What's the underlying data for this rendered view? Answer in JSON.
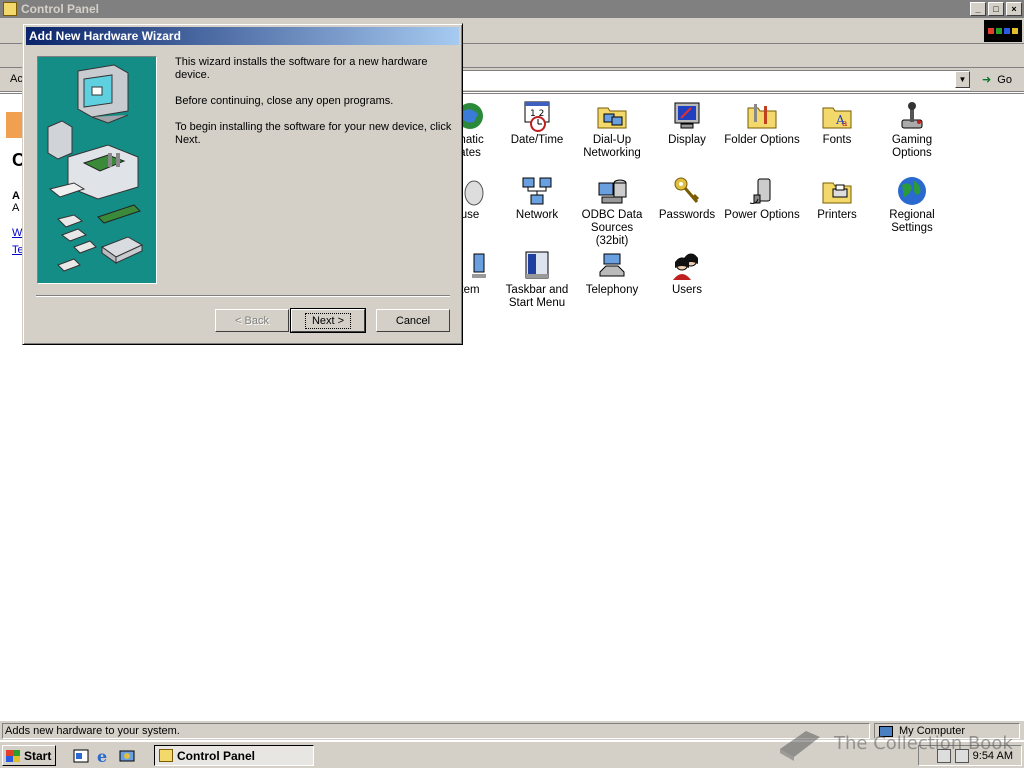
{
  "window": {
    "title": "Control Panel",
    "buttons": {
      "minimize": "_",
      "maximize": "□",
      "close": "×"
    }
  },
  "address": {
    "label_fragment": "Ac",
    "go_label": "Go"
  },
  "left_panel_fragment": {
    "title_letter": "C",
    "a1": "A",
    "a2": "A",
    "link1": "W",
    "link2": "Te"
  },
  "control_panel_items": [
    {
      "label1": "matic",
      "label2": "ates",
      "icon": "automatic-updates-icon"
    },
    {
      "label1": "Date/Time",
      "label2": "",
      "icon": "calendar-clock-icon"
    },
    {
      "label1": "Dial-Up",
      "label2": "Networking",
      "icon": "dial-up-folder-icon"
    },
    {
      "label1": "Display",
      "label2": "",
      "icon": "display-monitor-icon"
    },
    {
      "label1": "Folder Options",
      "label2": "",
      "icon": "folder-options-icon"
    },
    {
      "label1": "Fonts",
      "label2": "",
      "icon": "fonts-folder-icon"
    },
    {
      "label1": "Gaming",
      "label2": "Options",
      "icon": "joystick-icon"
    },
    {
      "label1": "use",
      "label2": "",
      "icon": "mouse-icon"
    },
    {
      "label1": "Network",
      "label2": "",
      "icon": "network-icon"
    },
    {
      "label1": "ODBC Data",
      "label2": "Sources (32bit)",
      "icon": "odbc-icon"
    },
    {
      "label1": "Passwords",
      "label2": "",
      "icon": "keys-icon"
    },
    {
      "label1": "Power Options",
      "label2": "",
      "icon": "power-plug-icon"
    },
    {
      "label1": "Printers",
      "label2": "",
      "icon": "printers-folder-icon"
    },
    {
      "label1": "Regional",
      "label2": "Settings",
      "icon": "globe-icon"
    },
    {
      "label1": "tem",
      "label2": "",
      "icon": "system-icon"
    },
    {
      "label1": "Taskbar and",
      "label2": "Start Menu",
      "icon": "taskbar-icon"
    },
    {
      "label1": "Telephony",
      "label2": "",
      "icon": "telephone-icon"
    },
    {
      "label1": "Users",
      "label2": "",
      "icon": "users-icon"
    }
  ],
  "dialog": {
    "title": "Add New Hardware Wizard",
    "para1": "This wizard installs the software for a new hardware device.",
    "para2": "Before continuing, close any open programs.",
    "para3": "To begin installing the software for your new device, click Next.",
    "back_label": "< Back",
    "next_label": "Next >",
    "cancel_label": "Cancel"
  },
  "statusbar": {
    "text": "Adds new hardware to your system.",
    "zone": "My Computer"
  },
  "taskbar": {
    "start_label": "Start",
    "task_label": "Control Panel",
    "clock": "9:54 AM"
  },
  "watermark": {
    "text": "The Collection Book"
  },
  "colors": {
    "dialog_title_start": "#0a246a",
    "dialog_title_end": "#a6caf0",
    "wizard_art_bg": "#158d87",
    "face": "#d4d0c8"
  }
}
